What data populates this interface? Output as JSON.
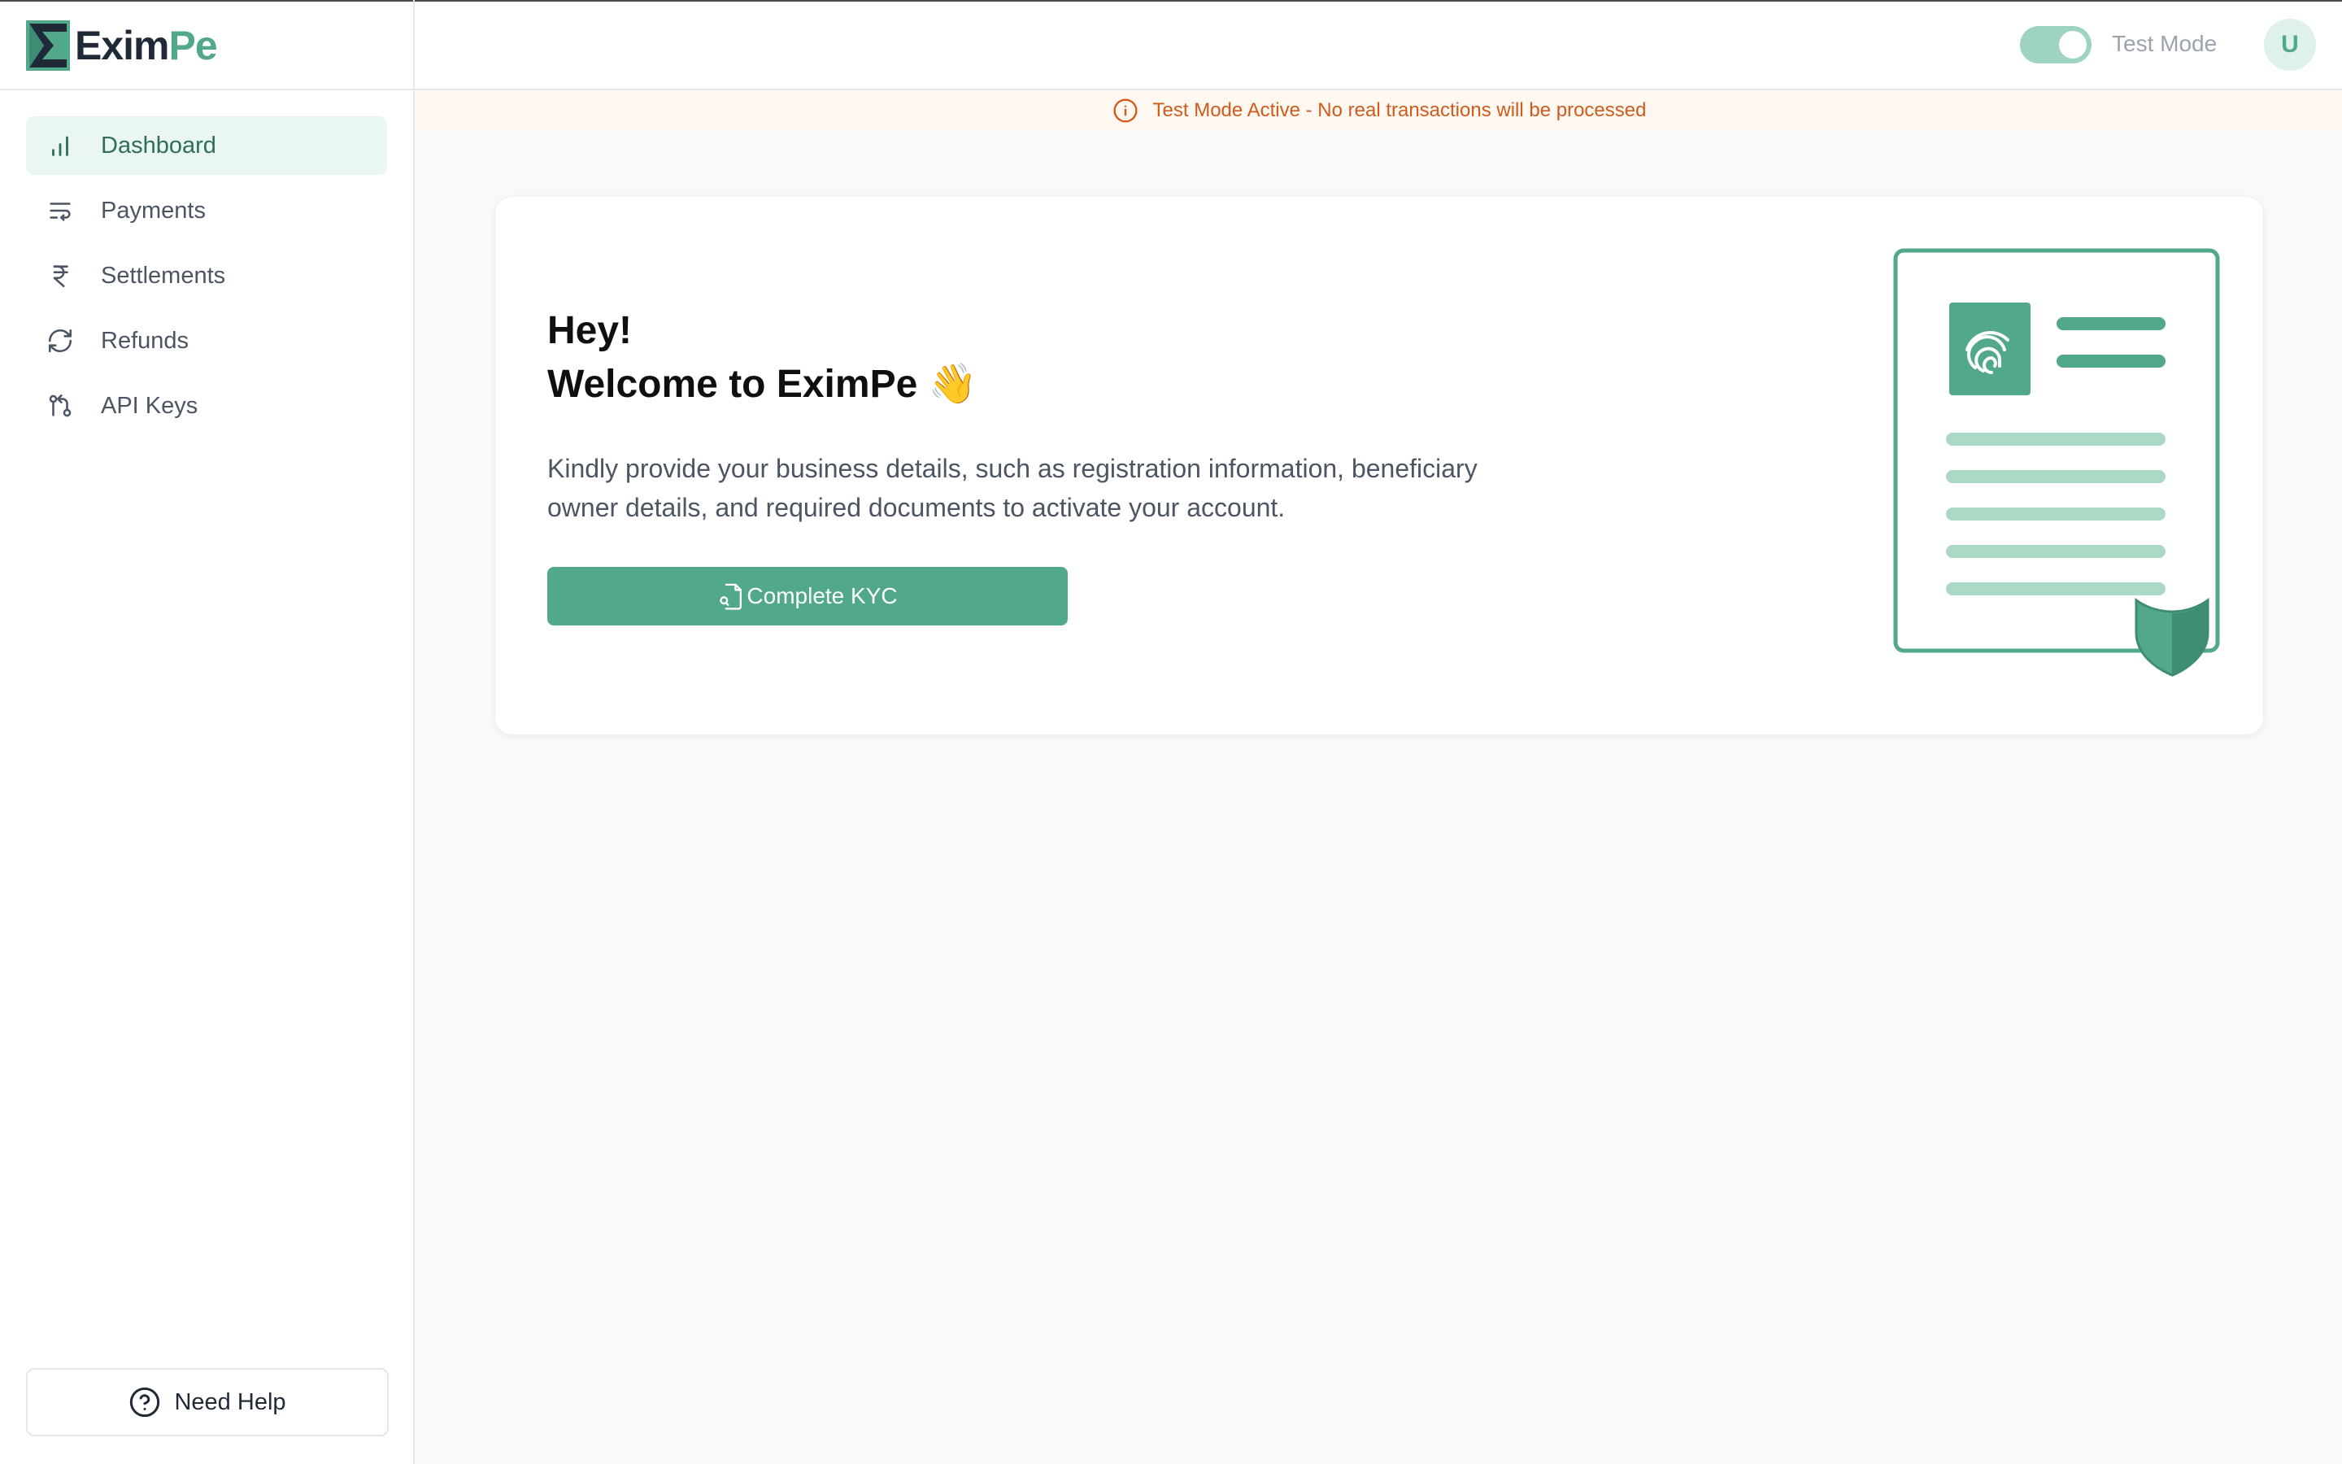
{
  "brand": {
    "name_part1": "Exim",
    "name_part2": "Pe",
    "accent": "#52a98a"
  },
  "sidebar": {
    "items": [
      {
        "label": "Dashboard",
        "icon": "bar-chart-icon",
        "active": true
      },
      {
        "label": "Payments",
        "icon": "payments-icon",
        "active": false
      },
      {
        "label": "Settlements",
        "icon": "rupee-icon",
        "active": false
      },
      {
        "label": "Refunds",
        "icon": "refresh-icon",
        "active": false
      },
      {
        "label": "API Keys",
        "icon": "git-compare-icon",
        "active": false
      }
    ],
    "help_label": "Need Help"
  },
  "header": {
    "test_mode_label": "Test Mode",
    "test_mode_on": true,
    "avatar_initial": "U"
  },
  "banner": {
    "text": "Test Mode Active - No real transactions will be processed",
    "color": "#cf5b1d"
  },
  "welcome_card": {
    "greeting": "Hey!",
    "title": "Welcome to EximPe 👋",
    "description": "Kindly provide your business details, such as registration information, beneficiary owner details, and required documents to activate your account.",
    "cta_label": "Complete KYC"
  }
}
